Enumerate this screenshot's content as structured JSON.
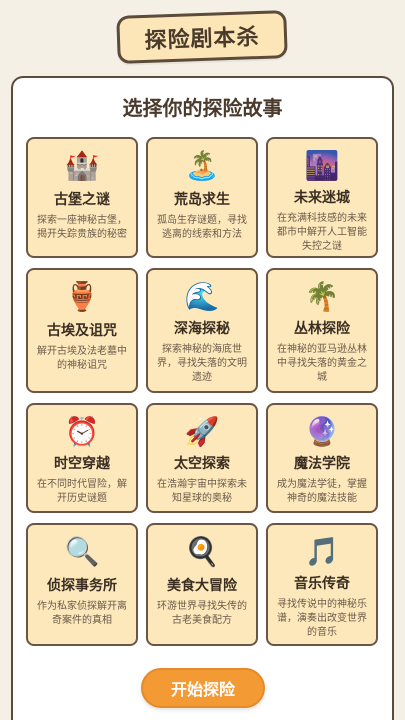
{
  "header": {
    "title": "探险剧本杀"
  },
  "main": {
    "subtitle": "选择你的探险故事",
    "stories": [
      {
        "icon": "🏰",
        "icon_name": "castle-icon",
        "name": "古堡之谜",
        "desc": "探索一座神秘古堡，揭开失踪贵族的秘密"
      },
      {
        "icon": "🏝️",
        "icon_name": "island-icon",
        "name": "荒岛求生",
        "desc": "孤岛生存谜题，寻找逃离的线索和方法"
      },
      {
        "icon": "🌆",
        "icon_name": "city-icon",
        "name": "未来迷城",
        "desc": "在充满科技感的未来都市中解开人工智能失控之谜"
      },
      {
        "icon": "🏺",
        "icon_name": "amphora-icon",
        "name": "古埃及诅咒",
        "desc": "解开古埃及法老墓中的神秘诅咒"
      },
      {
        "icon": "🌊",
        "icon_name": "wave-icon",
        "name": "深海探秘",
        "desc": "探索神秘的海底世界，寻找失落的文明遗迹"
      },
      {
        "icon": "🌴",
        "icon_name": "palm-tree-icon",
        "name": "丛林探险",
        "desc": "在神秘的亚马逊丛林中寻找失落的黄金之城"
      },
      {
        "icon": "⏰",
        "icon_name": "alarm-clock-icon",
        "name": "时空穿越",
        "desc": "在不同时代冒险，解开历史谜题"
      },
      {
        "icon": "🚀",
        "icon_name": "rocket-icon",
        "name": "太空探索",
        "desc": "在浩瀚宇宙中探索未知星球的奥秘"
      },
      {
        "icon": "🔮",
        "icon_name": "crystal-ball-icon",
        "name": "魔法学院",
        "desc": "成为魔法学徒，掌握神奇的魔法技能"
      },
      {
        "icon": "🔍",
        "icon_name": "magnifier-icon",
        "name": "侦探事务所",
        "desc": "作为私家侦探解开离奇案件的真相"
      },
      {
        "icon": "🍳",
        "icon_name": "frying-pan-icon",
        "name": "美食大冒险",
        "desc": "环游世界寻找失传的古老美食配方"
      },
      {
        "icon": "🎵",
        "icon_name": "music-note-icon",
        "name": "音乐传奇",
        "desc": "寻找传说中的神秘乐谱，演奏出改变世界的音乐"
      }
    ]
  },
  "footer": {
    "start_label": "开始探险"
  },
  "colors": {
    "background": "#f5f0e6",
    "card": "#fde8bb",
    "accent": "#f39a35",
    "border": "#5c4a3a"
  }
}
